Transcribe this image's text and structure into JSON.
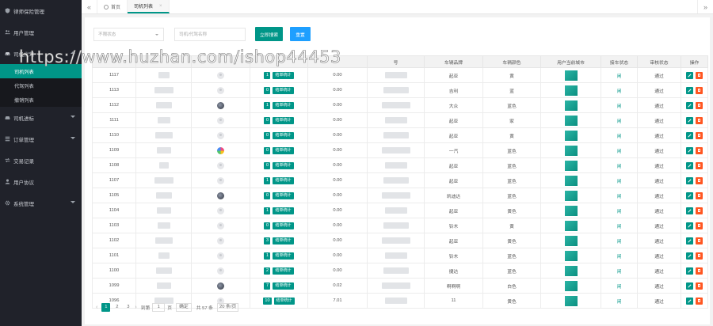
{
  "sidebar": {
    "items": [
      {
        "label": "律师保险管理",
        "icon": "shield-icon"
      },
      {
        "label": "用户管理",
        "icon": "users-icon"
      },
      {
        "label": "司机代驾",
        "icon": "car-icon",
        "expanded": true
      },
      {
        "label": "司机进标",
        "icon": "car-icon"
      },
      {
        "label": "订单管理",
        "icon": "list-icon"
      },
      {
        "label": "交易记录",
        "icon": "exchange-icon"
      },
      {
        "label": "用户协议",
        "icon": "user-icon"
      },
      {
        "label": "系统管理",
        "icon": "gear-icon"
      }
    ],
    "sub_items": [
      "司机列表",
      "代驾列表",
      "撤销列表"
    ]
  },
  "topbar": {
    "left_arrows": "«",
    "home_tab": "首页",
    "active_tab": "司机列表",
    "close": "×",
    "right_arrows": "»"
  },
  "filters": {
    "status_placeholder": "不限状态",
    "name_placeholder": "司机/代驾名称",
    "search_label": "立即搜索",
    "reset_label": "重置"
  },
  "table": {
    "headers": [
      "ID",
      "",
      "",
      "",
      "",
      "号",
      "车辆品牌",
      "车辆颜色",
      "用户当前城市",
      "接车状态",
      "审核状态",
      "操作"
    ],
    "rows": [
      {
        "id": "1117",
        "avatar": "default",
        "count": "1",
        "stat": "结单统计",
        "amount": "0.00",
        "plate": "",
        "brand": "起亚",
        "color": "黄",
        "pickup": "闲",
        "audit": "通过"
      },
      {
        "id": "1113",
        "avatar": "default",
        "count": "0",
        "stat": "结单统计",
        "amount": "0.00",
        "plate": "",
        "brand": "吉利",
        "color": "蓝",
        "pickup": "闲",
        "audit": "通过"
      },
      {
        "id": "1112",
        "avatar": "photo",
        "count": "1",
        "stat": "结单统计",
        "amount": "0.00",
        "plate": "",
        "brand": "大众",
        "color": "蓝色",
        "pickup": "闲",
        "audit": "通过"
      },
      {
        "id": "1111",
        "avatar": "default",
        "count": "0",
        "stat": "结单统计",
        "amount": "0.00",
        "plate": "",
        "brand": "起亚",
        "color": "家",
        "pickup": "闲",
        "audit": "通过"
      },
      {
        "id": "1110",
        "avatar": "default",
        "count": "0",
        "stat": "结单统计",
        "amount": "0.00",
        "plate": "",
        "brand": "起亚",
        "color": "黄",
        "pickup": "闲",
        "audit": "通过"
      },
      {
        "id": "1109",
        "avatar": "flower",
        "count": "0",
        "stat": "结单统计",
        "amount": "0.00",
        "plate": "",
        "brand": "一汽",
        "color": "蓝色",
        "pickup": "闲",
        "audit": "通过"
      },
      {
        "id": "1108",
        "avatar": "default",
        "count": "0",
        "stat": "结单统计",
        "amount": "0.00",
        "plate": "",
        "brand": "起亚",
        "color": "蓝色",
        "pickup": "闲",
        "audit": "通过"
      },
      {
        "id": "1107",
        "avatar": "default",
        "count": "1",
        "stat": "结单统计",
        "amount": "0.00",
        "plate": "",
        "brand": "起亚",
        "color": "蓝色",
        "pickup": "闲",
        "audit": "通过"
      },
      {
        "id": "1105",
        "avatar": "photo",
        "count": "0",
        "stat": "结单统计",
        "amount": "0.00",
        "plate": "",
        "brand": "凯迪达",
        "color": "蓝色",
        "pickup": "闲",
        "audit": "通过"
      },
      {
        "id": "1104",
        "avatar": "default",
        "count": "1",
        "stat": "结单统计",
        "amount": "0.00",
        "plate": "",
        "brand": "起亚",
        "color": "黄色",
        "pickup": "闲",
        "audit": "通过"
      },
      {
        "id": "1103",
        "avatar": "default",
        "count": "0",
        "stat": "结单统计",
        "amount": "0.00",
        "plate": "",
        "brand": "铃木",
        "color": "黄",
        "pickup": "闲",
        "audit": "通过"
      },
      {
        "id": "1102",
        "avatar": "default",
        "count": "3",
        "stat": "结单统计",
        "amount": "0.00",
        "plate": "",
        "brand": "起亚",
        "color": "黄色",
        "pickup": "闲",
        "audit": "通过"
      },
      {
        "id": "1101",
        "avatar": "default",
        "count": "1",
        "stat": "结单统计",
        "amount": "0.00",
        "plate": "",
        "brand": "铃木",
        "color": "蓝色",
        "pickup": "闲",
        "audit": "通过"
      },
      {
        "id": "1100",
        "avatar": "default",
        "count": "2",
        "stat": "结单统计",
        "amount": "0.00",
        "plate": "",
        "brand": "捷达",
        "color": "蓝色",
        "pickup": "闲",
        "audit": "通过"
      },
      {
        "id": "1099",
        "avatar": "photo",
        "count": "7",
        "stat": "结单统计",
        "amount": "0.02",
        "plate": "",
        "brand": "啊啊啊",
        "color": "白色",
        "pickup": "闲",
        "audit": "通过"
      },
      {
        "id": "1096",
        "avatar": "default",
        "count": "10",
        "stat": "结单统计",
        "amount": "7.01",
        "plate": "",
        "brand": "11",
        "color": "黄色",
        "pickup": "闲",
        "audit": "通过"
      }
    ]
  },
  "pagination": {
    "prev": "‹",
    "pages": [
      "1",
      "2",
      "3"
    ],
    "current": "1",
    "next": "›",
    "goto_label": "到第",
    "goto_value": "1",
    "page_unit": "页",
    "confirm": "确定",
    "total": "共 57 条",
    "page_size": "20 条/页"
  },
  "watermark": "https://www.huzhan.com/ishop44453",
  "colors": {
    "accent": "#009688",
    "blue": "#1e9fff",
    "danger": "#ff5722",
    "sidebar": "#20222a"
  }
}
